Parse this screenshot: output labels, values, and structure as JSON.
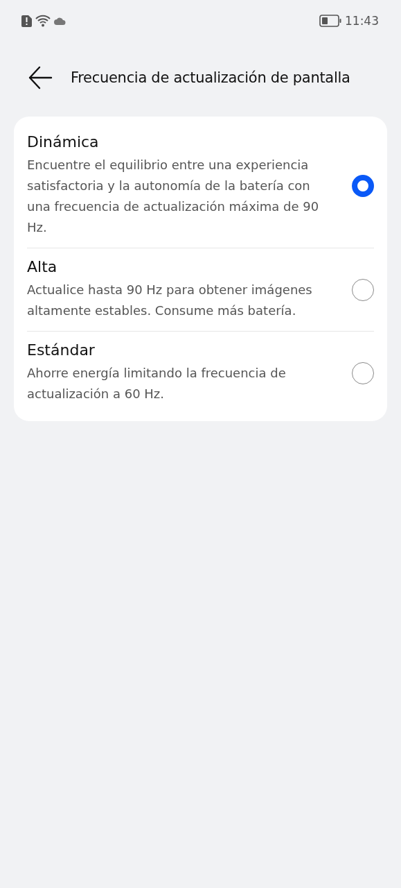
{
  "status_bar": {
    "time": "11:43"
  },
  "header": {
    "title": "Frecuencia de actualización de pantalla"
  },
  "options": [
    {
      "title": "Dinámica",
      "description": "Encuentre el equilibrio entre una experiencia satisfactoria y la autonomía de la batería con una frecuencia de actualización máxima de 90 Hz.",
      "selected": true
    },
    {
      "title": "Alta",
      "description": "Actualice hasta 90 Hz para obtener imágenes altamente estables. Consume más batería.",
      "selected": false
    },
    {
      "title": "Estándar",
      "description": "Ahorre energía limitando la frecuencia de actualización a 60 Hz.",
      "selected": false
    }
  ]
}
